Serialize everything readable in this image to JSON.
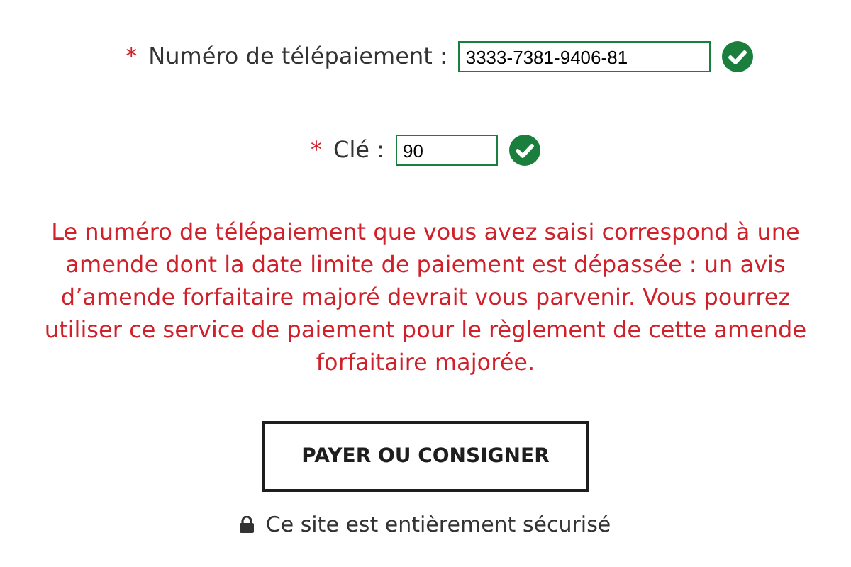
{
  "fields": [
    {
      "marker": "*",
      "label": "Numéro de télépaiement :",
      "value": "3333-7381-9406-81",
      "valid": true
    },
    {
      "marker": "*",
      "label": "Clé :",
      "value": "90",
      "valid": true
    }
  ],
  "error_message": "Le numéro de télépaiement que vous avez saisi correspond à une amende dont la date limite de paiement est dépassée : un avis d’amende forfaitaire majoré devrait vous parvenir. Vous pourrez utiliser ce service de paiement pour le règlement de cette amende forfaitaire majorée.",
  "submit_button": "PAYER OU CONSIGNER",
  "secure_note": "Ce site est entièrement sécurisé"
}
